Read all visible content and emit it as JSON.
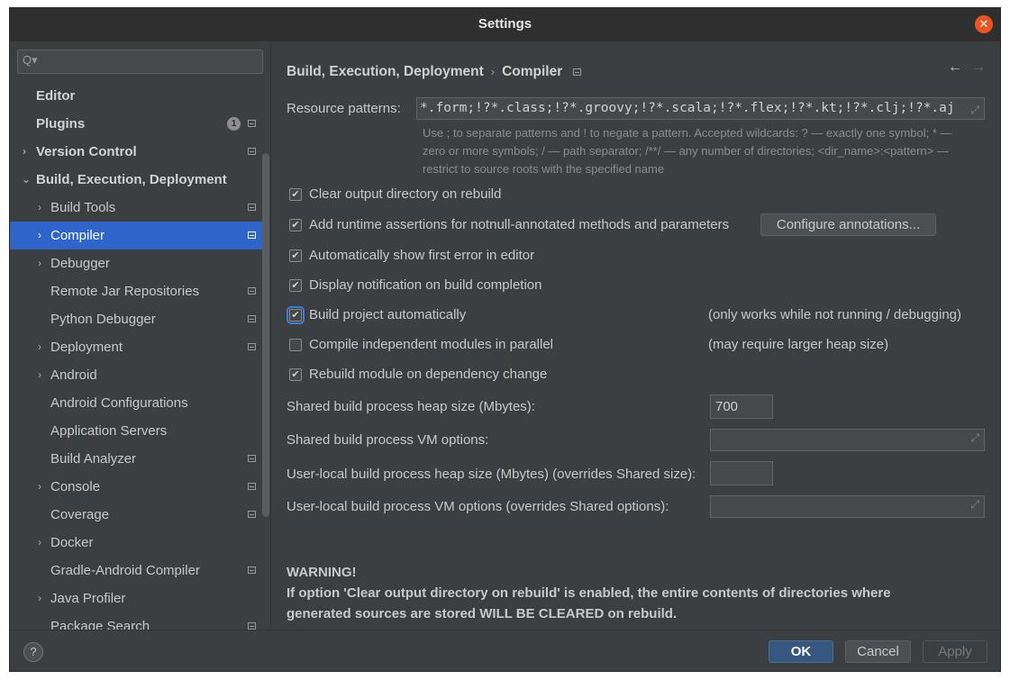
{
  "window": {
    "title": "Settings"
  },
  "sidebar": {
    "search_placeholder": "",
    "plugins_badge": "1",
    "items": [
      {
        "label": "Editor"
      },
      {
        "label": "Plugins"
      },
      {
        "label": "Version Control"
      },
      {
        "label": "Build, Execution, Deployment"
      },
      {
        "label": "Build Tools"
      },
      {
        "label": "Compiler"
      },
      {
        "label": "Debugger"
      },
      {
        "label": "Remote Jar Repositories"
      },
      {
        "label": "Python Debugger"
      },
      {
        "label": "Deployment"
      },
      {
        "label": "Android"
      },
      {
        "label": "Android Configurations"
      },
      {
        "label": "Application Servers"
      },
      {
        "label": "Build Analyzer"
      },
      {
        "label": "Console"
      },
      {
        "label": "Coverage"
      },
      {
        "label": "Docker"
      },
      {
        "label": "Gradle-Android Compiler"
      },
      {
        "label": "Java Profiler"
      },
      {
        "label": "Package Search"
      }
    ]
  },
  "breadcrumb": {
    "parent": "Build, Execution, Deployment",
    "current": "Compiler"
  },
  "compiler": {
    "resource_patterns_label": "Resource patterns:",
    "resource_patterns_value": "*.form;!?*.class;!?*.groovy;!?*.scala;!?*.flex;!?*.kt;!?*.clj;!?*.aj",
    "hint_line1": "Use ; to separate patterns and ! to negate a pattern. Accepted wildcards: ? — exactly one symbol; * —",
    "hint_line2": "zero or more symbols; / — path separator; /**/ — any number of directories; <dir_name>:<pattern> —",
    "hint_line3": "restrict to source roots with the specified name",
    "checkboxes": [
      {
        "label": "Clear output directory on rebuild",
        "checked": true
      },
      {
        "label": "Add runtime assertions for notnull-annotated methods and parameters",
        "checked": true
      },
      {
        "label": "Automatically show first error in editor",
        "checked": true
      },
      {
        "label": "Display notification on build completion",
        "checked": true
      },
      {
        "label": "Build project automatically",
        "checked": true
      },
      {
        "label": "Compile independent modules in parallel",
        "checked": false
      },
      {
        "label": "Rebuild module on dependency change",
        "checked": true
      }
    ],
    "configure_annotations_label": "Configure annotations...",
    "build_auto_note": "(only works while not running / debugging)",
    "parallel_note": "(may require larger heap size)",
    "heap_size_label": "Shared build process heap size (Mbytes):",
    "heap_size_value": "700",
    "vm_options_label": "Shared build process VM options:",
    "vm_options_value": "",
    "user_heap_label": "User-local build process heap size (Mbytes) (overrides Shared size):",
    "user_heap_value": "",
    "user_vm_label": "User-local build process VM options (overrides Shared options):",
    "user_vm_value": "",
    "warning_title": "WARNING!",
    "warning_line1": "If option 'Clear output directory on rebuild' is enabled, the entire contents of directories where",
    "warning_line2": "generated sources are stored WILL BE CLEARED on rebuild."
  },
  "footer": {
    "help": "?",
    "ok": "OK",
    "cancel": "Cancel",
    "apply": "Apply"
  },
  "colors": {
    "accent": "#2f65ca",
    "background": "#3c3f41",
    "close": "#e95420"
  }
}
